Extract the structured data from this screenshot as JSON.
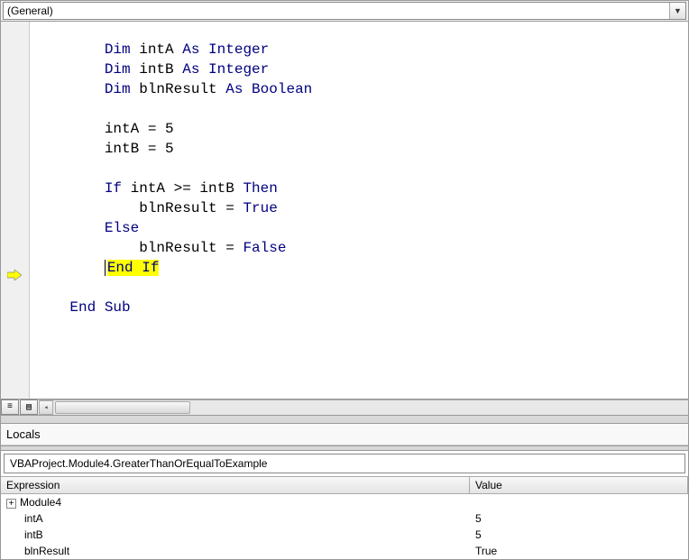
{
  "dropdown": {
    "value": "(General)"
  },
  "code": {
    "lines": [
      {
        "indent": 2,
        "tokens": [
          {
            "t": "Dim",
            "c": "kw"
          },
          {
            "t": " intA "
          },
          {
            "t": "As Integer",
            "c": "kw"
          }
        ]
      },
      {
        "indent": 2,
        "tokens": [
          {
            "t": "Dim",
            "c": "kw"
          },
          {
            "t": " intB "
          },
          {
            "t": "As Integer",
            "c": "kw"
          }
        ]
      },
      {
        "indent": 2,
        "tokens": [
          {
            "t": "Dim",
            "c": "kw"
          },
          {
            "t": " blnResult "
          },
          {
            "t": "As Boolean",
            "c": "kw"
          }
        ]
      },
      {
        "indent": 0,
        "tokens": []
      },
      {
        "indent": 2,
        "tokens": [
          {
            "t": "intA = 5"
          }
        ]
      },
      {
        "indent": 2,
        "tokens": [
          {
            "t": "intB = 5"
          }
        ]
      },
      {
        "indent": 0,
        "tokens": []
      },
      {
        "indent": 2,
        "tokens": [
          {
            "t": "If",
            "c": "kw"
          },
          {
            "t": " intA >= intB "
          },
          {
            "t": "Then",
            "c": "kw"
          }
        ]
      },
      {
        "indent": 3,
        "tokens": [
          {
            "t": "blnResult = "
          },
          {
            "t": "True",
            "c": "kw"
          }
        ]
      },
      {
        "indent": 2,
        "tokens": [
          {
            "t": "Else",
            "c": "kw"
          }
        ]
      },
      {
        "indent": 3,
        "tokens": [
          {
            "t": "blnResult = "
          },
          {
            "t": "False",
            "c": "kw"
          }
        ]
      },
      {
        "indent": 2,
        "tokens": [
          {
            "t": "End If",
            "c": "kw",
            "hl": true
          }
        ],
        "exec": true
      },
      {
        "indent": 0,
        "tokens": []
      },
      {
        "indent": 1,
        "tokens": [
          {
            "t": "End Sub",
            "c": "kw"
          }
        ]
      }
    ]
  },
  "locals": {
    "title": "Locals",
    "context": "VBAProject.Module4.GreaterThanOrEqualToExample",
    "headers": {
      "expr": "Expression",
      "val": "Value"
    },
    "rows": [
      {
        "name": "Module4",
        "value": "",
        "expandable": true,
        "indent": 0
      },
      {
        "name": "intA",
        "value": "5",
        "indent": 1
      },
      {
        "name": "intB",
        "value": "5",
        "indent": 1
      },
      {
        "name": "blnResult",
        "value": "True",
        "indent": 1
      }
    ]
  }
}
